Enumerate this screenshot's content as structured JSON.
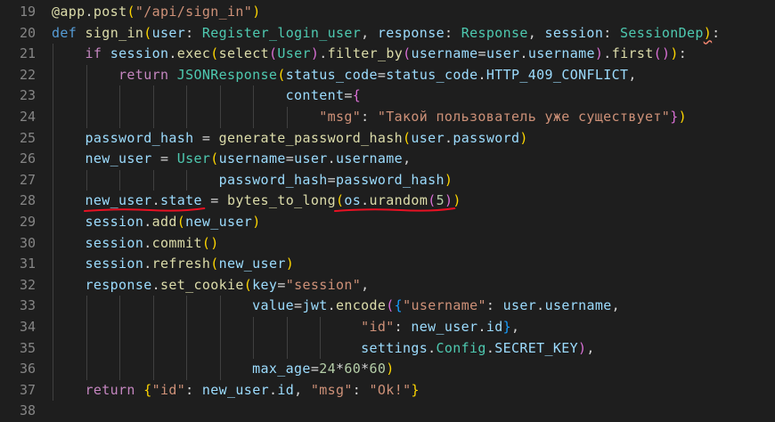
{
  "editor": {
    "lines": [
      {
        "n": "19",
        "tokens": [
          [
            "dec",
            "@app"
          ],
          [
            "o",
            "."
          ],
          [
            "f",
            "post"
          ],
          [
            "b1",
            "("
          ],
          [
            "s",
            "\"/api/sign_in\""
          ],
          [
            "b1",
            ")"
          ]
        ]
      },
      {
        "n": "20",
        "tokens": [
          [
            "k",
            "def"
          ],
          [
            "o",
            " "
          ],
          [
            "f",
            "sign_in"
          ],
          [
            "b1",
            "("
          ],
          [
            "v",
            "user"
          ],
          [
            "o",
            ": "
          ],
          [
            "c",
            "Register_login_user"
          ],
          [
            "o",
            ", "
          ],
          [
            "v",
            "response"
          ],
          [
            "o",
            ": "
          ],
          [
            "c",
            "Response"
          ],
          [
            "o",
            ", "
          ],
          [
            "v",
            "session"
          ],
          [
            "o",
            ": "
          ],
          [
            "c",
            "SessionDep"
          ],
          [
            "b1",
            "sq)"
          ],
          [
            "o",
            ":"
          ]
        ]
      },
      {
        "n": "21",
        "tokens": [
          [
            "o",
            "    "
          ],
          [
            "kc",
            "if"
          ],
          [
            "o",
            " "
          ],
          [
            "v",
            "session"
          ],
          [
            "o",
            "."
          ],
          [
            "f",
            "exec"
          ],
          [
            "b1",
            "("
          ],
          [
            "f",
            "select"
          ],
          [
            "b2",
            "("
          ],
          [
            "c",
            "User"
          ],
          [
            "b2",
            ")"
          ],
          [
            "o",
            "."
          ],
          [
            "f",
            "filter_by"
          ],
          [
            "b2",
            "("
          ],
          [
            "v",
            "username"
          ],
          [
            "o",
            "="
          ],
          [
            "v",
            "user"
          ],
          [
            "o",
            "."
          ],
          [
            "v",
            "username"
          ],
          [
            "b2",
            ")"
          ],
          [
            "o",
            "."
          ],
          [
            "f",
            "first"
          ],
          [
            "b2",
            "()"
          ],
          [
            "b1",
            ")"
          ],
          [
            "o",
            ":"
          ]
        ]
      },
      {
        "n": "22",
        "tokens": [
          [
            "o",
            "        "
          ],
          [
            "kc",
            "return"
          ],
          [
            "o",
            " "
          ],
          [
            "c",
            "JSONResponse"
          ],
          [
            "b1",
            "("
          ],
          [
            "v",
            "status_code"
          ],
          [
            "o",
            "="
          ],
          [
            "v",
            "status_code"
          ],
          [
            "o",
            "."
          ],
          [
            "v",
            "HTTP_409_CONFLICT"
          ],
          [
            "o",
            ","
          ]
        ]
      },
      {
        "n": "23",
        "tokens": [
          [
            "o",
            "                            "
          ],
          [
            "v",
            "content"
          ],
          [
            "o",
            "="
          ],
          [
            "b2",
            "{"
          ]
        ]
      },
      {
        "n": "24",
        "tokens": [
          [
            "o",
            "                                "
          ],
          [
            "s",
            "\"msg\""
          ],
          [
            "o",
            ": "
          ],
          [
            "s",
            "\"Такой пользователь уже существует\""
          ],
          [
            "b2",
            "}"
          ],
          [
            "b1",
            ")"
          ]
        ]
      },
      {
        "n": "25",
        "tokens": [
          [
            "o",
            "    "
          ],
          [
            "v",
            "password_hash"
          ],
          [
            "o",
            " = "
          ],
          [
            "f",
            "generate_password_hash"
          ],
          [
            "b1",
            "("
          ],
          [
            "v",
            "user"
          ],
          [
            "o",
            "."
          ],
          [
            "v",
            "password"
          ],
          [
            "b1",
            ")"
          ]
        ]
      },
      {
        "n": "26",
        "tokens": [
          [
            "o",
            "    "
          ],
          [
            "v",
            "new_user"
          ],
          [
            "o",
            " = "
          ],
          [
            "c",
            "User"
          ],
          [
            "b1",
            "("
          ],
          [
            "v",
            "username"
          ],
          [
            "o",
            "="
          ],
          [
            "v",
            "user"
          ],
          [
            "o",
            "."
          ],
          [
            "v",
            "username"
          ],
          [
            "o",
            ","
          ]
        ]
      },
      {
        "n": "27",
        "tokens": [
          [
            "o",
            "                    "
          ],
          [
            "v",
            "password_hash"
          ],
          [
            "o",
            "="
          ],
          [
            "v",
            "password_hash"
          ],
          [
            "b1",
            ")"
          ]
        ]
      },
      {
        "n": "28",
        "tokens": [
          [
            "o",
            "    "
          ],
          [
            "v",
            "new_user"
          ],
          [
            "o",
            "."
          ],
          [
            "v",
            "state"
          ],
          [
            "o",
            " = "
          ],
          [
            "f",
            "bytes_to_long"
          ],
          [
            "b1",
            "("
          ],
          [
            "v",
            "os"
          ],
          [
            "o",
            "."
          ],
          [
            "f",
            "urandom"
          ],
          [
            "b2",
            "("
          ],
          [
            "n",
            "5"
          ],
          [
            "b2",
            ")"
          ],
          [
            "b1",
            ")"
          ]
        ]
      },
      {
        "n": "29",
        "tokens": [
          [
            "o",
            "    "
          ],
          [
            "v",
            "session"
          ],
          [
            "o",
            "."
          ],
          [
            "f",
            "add"
          ],
          [
            "b1",
            "("
          ],
          [
            "v",
            "new_user"
          ],
          [
            "b1",
            ")"
          ]
        ]
      },
      {
        "n": "30",
        "tokens": [
          [
            "o",
            "    "
          ],
          [
            "v",
            "session"
          ],
          [
            "o",
            "."
          ],
          [
            "f",
            "commit"
          ],
          [
            "b1",
            "()"
          ]
        ]
      },
      {
        "n": "31",
        "tokens": [
          [
            "o",
            "    "
          ],
          [
            "v",
            "session"
          ],
          [
            "o",
            "."
          ],
          [
            "f",
            "refresh"
          ],
          [
            "b1",
            "("
          ],
          [
            "v",
            "new_user"
          ],
          [
            "b1",
            ")"
          ]
        ]
      },
      {
        "n": "32",
        "tokens": [
          [
            "o",
            "    "
          ],
          [
            "v",
            "response"
          ],
          [
            "o",
            "."
          ],
          [
            "f",
            "set_cookie"
          ],
          [
            "b1",
            "("
          ],
          [
            "v",
            "key"
          ],
          [
            "o",
            "="
          ],
          [
            "s",
            "\"session\""
          ],
          [
            "o",
            ","
          ]
        ]
      },
      {
        "n": "33",
        "tokens": [
          [
            "o",
            "                        "
          ],
          [
            "v",
            "value"
          ],
          [
            "o",
            "="
          ],
          [
            "v",
            "jwt"
          ],
          [
            "o",
            "."
          ],
          [
            "f",
            "encode"
          ],
          [
            "b2",
            "("
          ],
          [
            "b3",
            "{"
          ],
          [
            "s",
            "\"username\""
          ],
          [
            "o",
            ": "
          ],
          [
            "v",
            "user"
          ],
          [
            "o",
            "."
          ],
          [
            "v",
            "username"
          ],
          [
            "o",
            ","
          ]
        ]
      },
      {
        "n": "34",
        "tokens": [
          [
            "o",
            "                                     "
          ],
          [
            "s",
            "\"id\""
          ],
          [
            "o",
            ": "
          ],
          [
            "v",
            "new_user"
          ],
          [
            "o",
            "."
          ],
          [
            "v",
            "id"
          ],
          [
            "b3",
            "}"
          ],
          [
            "o",
            ","
          ]
        ]
      },
      {
        "n": "35",
        "tokens": [
          [
            "o",
            "                                     "
          ],
          [
            "v",
            "settings"
          ],
          [
            "o",
            "."
          ],
          [
            "c",
            "Config"
          ],
          [
            "o",
            "."
          ],
          [
            "v",
            "SECRET_KEY"
          ],
          [
            "b2",
            ")"
          ],
          [
            "o",
            ","
          ]
        ]
      },
      {
        "n": "36",
        "tokens": [
          [
            "o",
            "                        "
          ],
          [
            "v",
            "max_age"
          ],
          [
            "o",
            "="
          ],
          [
            "n",
            "24"
          ],
          [
            "o",
            "*"
          ],
          [
            "n",
            "60"
          ],
          [
            "o",
            "*"
          ],
          [
            "n",
            "60"
          ],
          [
            "b1",
            ")"
          ]
        ]
      },
      {
        "n": "37",
        "tokens": [
          [
            "o",
            "    "
          ],
          [
            "kc",
            "return"
          ],
          [
            "o",
            " "
          ],
          [
            "b1",
            "{"
          ],
          [
            "s",
            "\"id\""
          ],
          [
            "o",
            ": "
          ],
          [
            "v",
            "new_user"
          ],
          [
            "o",
            "."
          ],
          [
            "v",
            "id"
          ],
          [
            "o",
            ", "
          ],
          [
            "s",
            "\"msg\""
          ],
          [
            "o",
            ": "
          ],
          [
            "s",
            "\"Ok!\""
          ],
          [
            "b1",
            "}"
          ]
        ]
      },
      {
        "n": "38",
        "tokens": []
      }
    ]
  },
  "colors": {
    "background": "#1e1e1e",
    "annotation_red": "#e81123",
    "line_number": "#858585"
  },
  "annotations": [
    "underline-new-user-state",
    "underline-os-urandom"
  ]
}
